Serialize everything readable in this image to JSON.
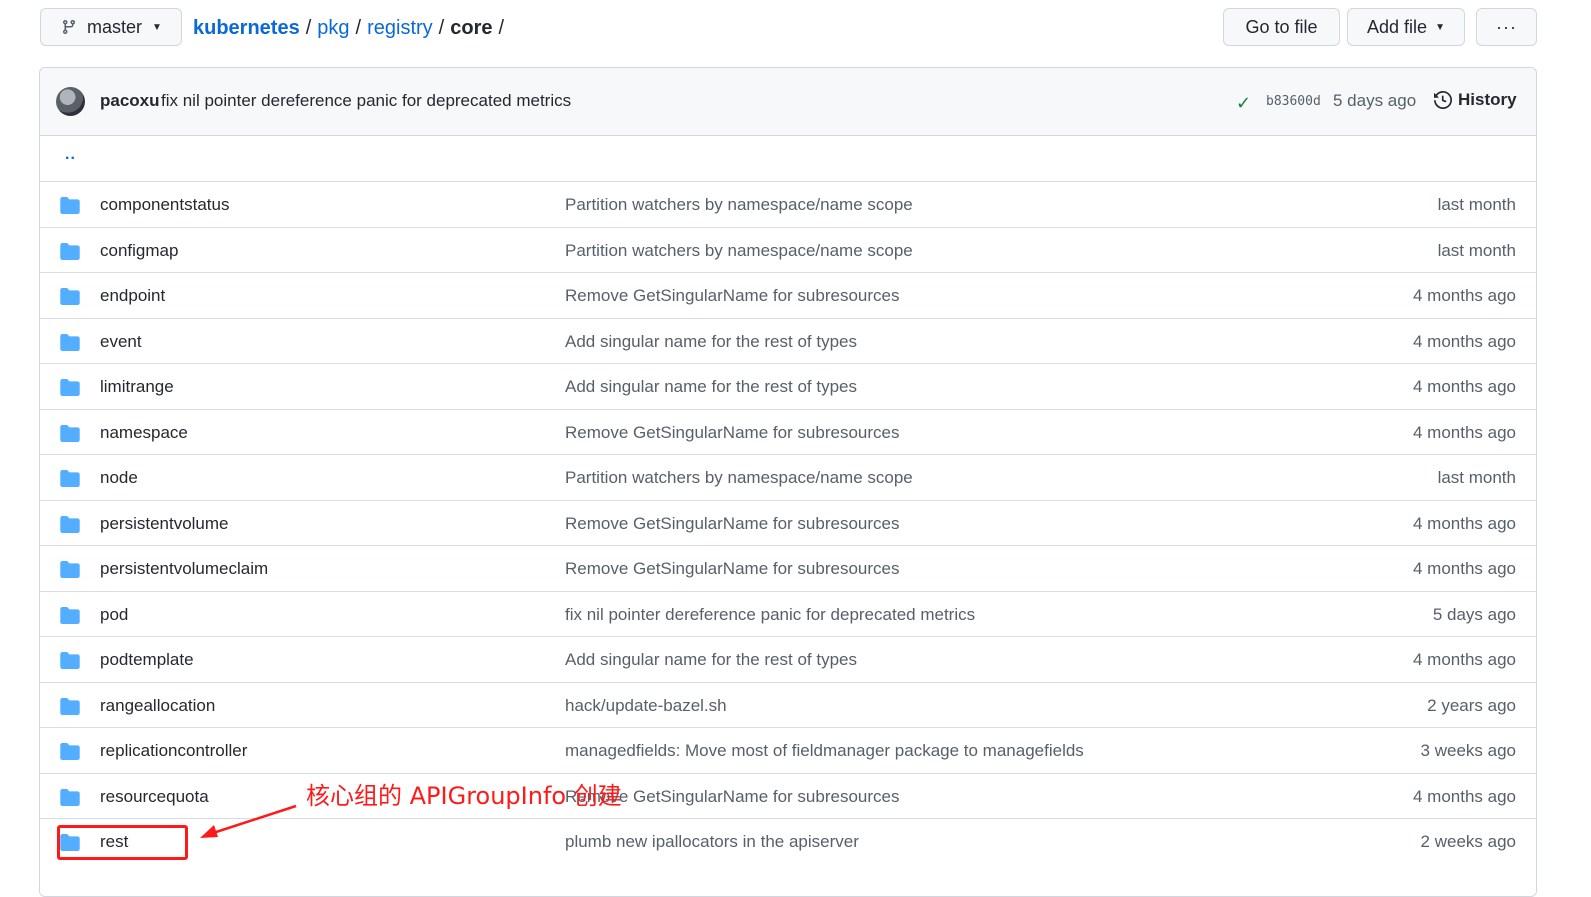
{
  "branch": {
    "label": "master"
  },
  "breadcrumb": {
    "repo": "kubernetes",
    "parts": [
      "pkg",
      "registry"
    ],
    "current": "core",
    "separator": "/"
  },
  "buttons": {
    "goto": "Go to file",
    "add": "Add file",
    "more": "···"
  },
  "commit": {
    "author": "pacoxu",
    "message": "fix nil pointer dereference panic for deprecated metrics",
    "sha": "b83600d",
    "time": "5 days ago",
    "history": "History"
  },
  "updir": "..",
  "files": [
    {
      "name": "componentstatus",
      "message": "Partition watchers by namespace/name scope",
      "age": "last month"
    },
    {
      "name": "configmap",
      "message": "Partition watchers by namespace/name scope",
      "age": "last month"
    },
    {
      "name": "endpoint",
      "message": "Remove GetSingularName for subresources",
      "age": "4 months ago"
    },
    {
      "name": "event",
      "message": "Add singular name for the rest of types",
      "age": "4 months ago"
    },
    {
      "name": "limitrange",
      "message": "Add singular name for the rest of types",
      "age": "4 months ago"
    },
    {
      "name": "namespace",
      "message": "Remove GetSingularName for subresources",
      "age": "4 months ago"
    },
    {
      "name": "node",
      "message": "Partition watchers by namespace/name scope",
      "age": "last month"
    },
    {
      "name": "persistentvolume",
      "message": "Remove GetSingularName for subresources",
      "age": "4 months ago"
    },
    {
      "name": "persistentvolumeclaim",
      "message": "Remove GetSingularName for subresources",
      "age": "4 months ago"
    },
    {
      "name": "pod",
      "message": "fix nil pointer dereference panic for deprecated metrics",
      "age": "5 days ago"
    },
    {
      "name": "podtemplate",
      "message": "Add singular name for the rest of types",
      "age": "4 months ago"
    },
    {
      "name": "rangeallocation",
      "message": "hack/update-bazel.sh",
      "age": "2 years ago"
    },
    {
      "name": "replicationcontroller",
      "message": "managedfields: Move most of fieldmanager package to managefields",
      "age": "3 weeks ago"
    },
    {
      "name": "resourcequota",
      "message": "Remove GetSingularName for subresources",
      "age": "4 months ago"
    },
    {
      "name": "rest",
      "message": "plumb new ipallocators in the apiserver",
      "age": "2 weeks ago"
    }
  ],
  "annotation": {
    "text": "核心组的 APIGroupInfo 创建"
  },
  "colors": {
    "folder": "#54aeff",
    "link": "#0969da",
    "annotation": "#ff1a1a",
    "check": "#1a7f37"
  }
}
